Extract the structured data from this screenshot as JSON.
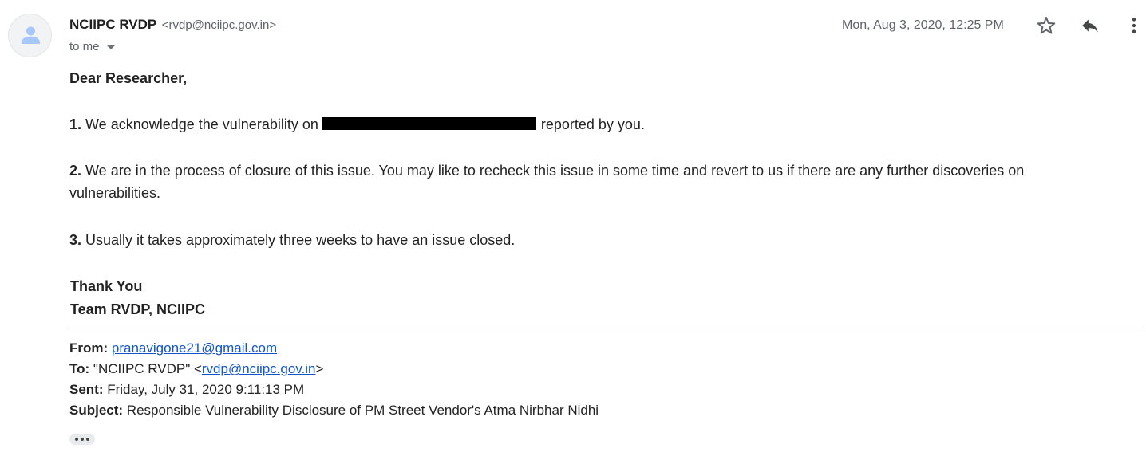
{
  "header": {
    "sender_name": "NCIIPC RVDP",
    "sender_email": "<rvdp@nciipc.gov.in>",
    "to_label": "to me",
    "date": "Mon, Aug 3, 2020, 12:25 PM",
    "icons": {
      "avatar": "avatar-icon",
      "star": "star-icon",
      "reply": "reply-icon",
      "more": "more-vert-icon",
      "recipients_caret": "chevron-down-icon"
    }
  },
  "body": {
    "greeting": "Dear Researcher,",
    "p1": {
      "num": "1.",
      "before": " We acknowledge the vulnerability on ",
      "after": " reported by you."
    },
    "p2": {
      "num": "2.",
      "text": " We are in the process of closure of this issue. You may like to recheck this issue in some time and revert to us if there are any further discoveries on vulnerabilities."
    },
    "p3": {
      "num": "3.",
      "text": " Usually it takes approximately three weeks to have an issue closed."
    },
    "signoff_1": "Thank You",
    "signoff_2": "Team RVDP, NCIIPC"
  },
  "quoted": {
    "from_label": "From:",
    "from_email": "pranavigone21@gmail.com",
    "to_label": "To:",
    "to_name": "\"NCIIPC RVDP\" <",
    "to_email": "rvdp@nciipc.gov.in",
    "to_close": ">",
    "sent_label": "Sent:",
    "sent_value": "Friday, July 31, 2020 9:11:13 PM",
    "subject_label": "Subject:",
    "subject_value": "Responsible Vulnerability Disclosure of PM Street Vendor's Atma Nirbhar Nidhi"
  },
  "colors": {
    "link": "#1155cc",
    "muted_text": "#5f6368",
    "body_text": "#222222",
    "avatar_bg": "#f1f3f4",
    "avatar_figure": "#a8c7fa"
  }
}
